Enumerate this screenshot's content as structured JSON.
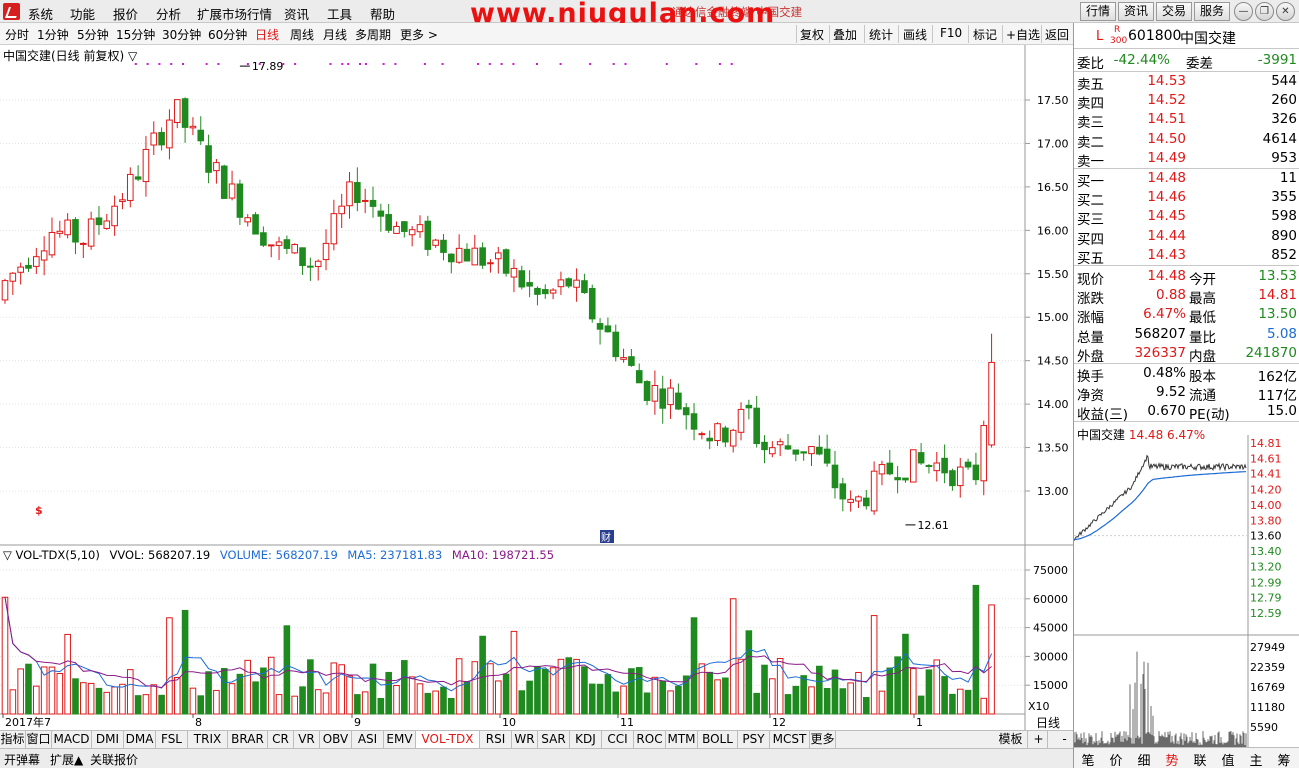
{
  "menu": {
    "items": [
      "系统",
      "功能",
      "报价",
      "分析",
      "扩展市场行情",
      "资讯",
      "工具",
      "帮助"
    ],
    "watermark": "www.niugulan.com",
    "title_caption": "通达信金融终端  中国交建",
    "right_buttons": [
      "行情",
      "资讯",
      "交易",
      "服务"
    ]
  },
  "periods": {
    "items": [
      "分时",
      "1分钟",
      "5分钟",
      "15分钟",
      "30分钟",
      "60分钟",
      "日线",
      "周线",
      "月线",
      "多周期",
      "更多 >"
    ],
    "active": "日线"
  },
  "tools": [
    "复权",
    "叠加",
    "统计",
    "画线",
    "F10",
    "标记",
    "+自选",
    "返回"
  ],
  "chart": {
    "header": "中国交建(日线 前复权) ▽",
    "high_marker": "17.89",
    "low_marker": "12.61",
    "y_ticks": [
      "17.50",
      "17.00",
      "16.50",
      "16.00",
      "15.50",
      "15.00",
      "14.50",
      "14.00",
      "13.50",
      "13.00"
    ],
    "marker_s": "$",
    "marker_cai": "财"
  },
  "volume": {
    "label": "▽ VOL-TDX(5,10)",
    "vvol": "VVOL: 568207.19",
    "vol": "VOLUME: 568207.19",
    "ma5": "MA5: 237181.83",
    "ma10": "MA10: 198721.55",
    "y_ticks": [
      "75000",
      "60000",
      "45000",
      "30000",
      "15000"
    ],
    "scale": "X10"
  },
  "date_axis": {
    "labels": [
      "2017年7",
      "8",
      "9",
      "10",
      "11",
      "12",
      "1"
    ],
    "right_label": "日线"
  },
  "indicator_tabs": {
    "items": [
      "指标",
      "窗口",
      "MACD",
      "DMI",
      "DMA",
      "FSL",
      "TRIX",
      "BRAR",
      "CR",
      "VR",
      "OBV",
      "ASI",
      "EMV",
      "VOL-TDX",
      "RSI",
      "WR",
      "SAR",
      "KDJ",
      "CCI",
      "ROC",
      "MTM",
      "BOLL",
      "PSY",
      "MCST",
      "更多"
    ],
    "active": "VOL-TDX",
    "right_items": [
      "模板",
      "+",
      "-"
    ]
  },
  "bottom_bar": [
    "开弹幕",
    "扩展▲",
    "关联报价"
  ],
  "quote": {
    "badge_l": "L",
    "badge_r": "R",
    "badge_300": "300",
    "code": "601800",
    "name": "中国交建",
    "webi_label": "委比",
    "webi": "-42.44%",
    "wecha_label": "委差",
    "wecha": "-3991",
    "asks": [
      {
        "label": "卖五",
        "price": "14.53",
        "vol": "544"
      },
      {
        "label": "卖四",
        "price": "14.52",
        "vol": "260"
      },
      {
        "label": "卖三",
        "price": "14.51",
        "vol": "326"
      },
      {
        "label": "卖二",
        "price": "14.50",
        "vol": "4614"
      },
      {
        "label": "卖一",
        "price": "14.49",
        "vol": "953"
      }
    ],
    "bids": [
      {
        "label": "买一",
        "price": "14.48",
        "vol": "11"
      },
      {
        "label": "买二",
        "price": "14.46",
        "vol": "355"
      },
      {
        "label": "买三",
        "price": "14.45",
        "vol": "598"
      },
      {
        "label": "买四",
        "price": "14.44",
        "vol": "890"
      },
      {
        "label": "买五",
        "price": "14.43",
        "vol": "852"
      }
    ],
    "stats": [
      {
        "l1": "现价",
        "v1": "14.48",
        "c1": "red",
        "l2": "今开",
        "v2": "13.53",
        "c2": "green"
      },
      {
        "l1": "涨跌",
        "v1": "0.88",
        "c1": "red",
        "l2": "最高",
        "v2": "14.81",
        "c2": "red"
      },
      {
        "l1": "涨幅",
        "v1": "6.47%",
        "c1": "red",
        "l2": "最低",
        "v2": "13.50",
        "c2": "green"
      },
      {
        "l1": "总量",
        "v1": "568207",
        "c1": "black",
        "l2": "量比",
        "v2": "5.08",
        "c2": "blue"
      },
      {
        "l1": "外盘",
        "v1": "326337",
        "c1": "red",
        "l2": "内盘",
        "v2": "241870",
        "c2": "green"
      }
    ],
    "stats2": [
      {
        "l1": "换手",
        "v1": "0.48%",
        "l2": "股本",
        "v2": "162亿"
      },
      {
        "l1": "净资",
        "v1": "9.52",
        "l2": "流通",
        "v2": "117亿"
      },
      {
        "l1": "收益(三)",
        "v1": "0.670",
        "l2": "PE(动)",
        "v2": "15.0"
      }
    ]
  },
  "mini_chart": {
    "name": "中国交建",
    "price": "14.48",
    "pct": "6.47%",
    "price_ticks_red": [
      "14.81",
      "14.61",
      "14.41",
      "14.20",
      "14.00",
      "13.80"
    ],
    "price_mid": "13.60",
    "price_ticks_green": [
      "13.40",
      "13.20",
      "12.99",
      "12.79",
      "12.59"
    ],
    "vol_ticks": [
      "27949",
      "22359",
      "16769",
      "11180",
      "5590"
    ]
  },
  "right_tabs": [
    "笔",
    "价",
    "细",
    "势",
    "联",
    "值",
    "主",
    "筹"
  ],
  "right_tab_active": "势"
}
